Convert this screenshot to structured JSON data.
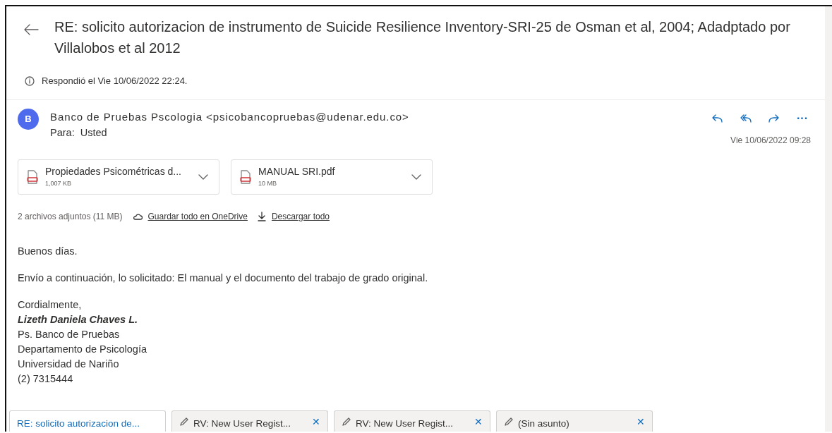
{
  "subject": "RE: solicito autorizacion de instrumento de Suicide Resilience Inventory-SRI-25 de Osman et al, 2004; Adadptado por Villalobos et al 2012",
  "info": "Respondió el Vie 10/06/2022 22:24.",
  "message": {
    "avatar": "B",
    "sender": "Banco de Pruebas Pscologia <psicobancopruebas@udenar.edu.co>",
    "to_label": "Para:",
    "to": "Usted",
    "date": "Vie 10/06/2022 09:28",
    "actions": [
      {
        "kind": "reply"
      },
      {
        "kind": "reply-all"
      },
      {
        "kind": "forward"
      },
      {
        "kind": "more",
        "label": "···"
      }
    ]
  },
  "attachments": [
    {
      "name": "Propiedades Psicométricas d...",
      "size": "1,007 KB"
    },
    {
      "name": "MANUAL SRI.pdf",
      "size": "10 MB"
    }
  ],
  "attachment_bar": [
    {
      "kind": "summary",
      "label": "2 archivos adjuntos (11 MB)"
    },
    {
      "kind": "cloud",
      "label": "Guardar todo en OneDrive"
    },
    {
      "kind": "download",
      "label": "Descargar todo"
    }
  ],
  "body": [
    [
      {
        "kind": "plain",
        "text": "Buenos días."
      }
    ],
    [
      {
        "kind": "plain",
        "text": "Envío a continuación, lo solicitado: El manual y el documento del trabajo de grado original."
      }
    ],
    [
      {
        "kind": "plain",
        "text": "Cordialmente,"
      },
      {
        "kind": "name",
        "text": "Lizeth Daniela Chaves L."
      },
      {
        "kind": "plain",
        "text": "Ps. Banco de Pruebas"
      },
      {
        "kind": "plain",
        "text": "Departamento de Psicología"
      },
      {
        "kind": "plain",
        "text": "Universidad de Nariño"
      },
      {
        "kind": "plain",
        "text": "(2) 7315444"
      }
    ]
  ],
  "tabs": [
    {
      "label": "RE: solicito autorizacion de...",
      "selected": true,
      "draft": false
    },
    {
      "label": "RV: New User Regist...",
      "selected": false,
      "draft": true,
      "close": "✕"
    },
    {
      "label": "RV: New User Regist...",
      "selected": false,
      "draft": true,
      "close": "✕"
    },
    {
      "label": "(Sin asunto)",
      "selected": false,
      "draft": true,
      "close": "✕"
    }
  ]
}
